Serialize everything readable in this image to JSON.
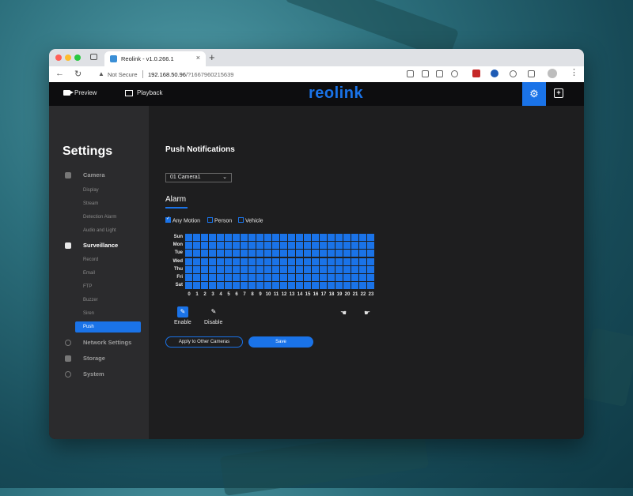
{
  "browser": {
    "tab_title": "Reolink - v1.0.266.1",
    "tab_close": "×",
    "new_tab": "+",
    "security_label": "Not Secure",
    "url_host": "192.168.50.96",
    "url_path": "/?1667960215639"
  },
  "app": {
    "logo": "reolink",
    "header_nav": [
      "Preview",
      "Playback"
    ]
  },
  "sidebar": {
    "title": "Settings",
    "sections": [
      {
        "label": "Camera",
        "icon": "camera-icon",
        "items": [
          "Display",
          "Stream",
          "Detection Alarm",
          "Audio and Light"
        ]
      },
      {
        "label": "Surveillance",
        "icon": "surveillance-icon",
        "active": true,
        "items": [
          "Record",
          "Email",
          "FTP",
          "Buzzer",
          "Siren",
          "Push"
        ]
      },
      {
        "label": "Network Settings",
        "icon": "globe-icon"
      },
      {
        "label": "Storage",
        "icon": "storage-icon"
      },
      {
        "label": "System",
        "icon": "gear-icon"
      }
    ],
    "active_item": "Push"
  },
  "main": {
    "title": "Push Notifications",
    "camera_select": "01  Camera1",
    "tab": "Alarm",
    "checkboxes": [
      {
        "label": "Any Motion",
        "checked": true
      },
      {
        "label": "Person",
        "checked": false
      },
      {
        "label": "Vehicle",
        "checked": false
      }
    ],
    "days": [
      "Sun",
      "Mon",
      "Tue",
      "Wed",
      "Thu",
      "Fri",
      "Sat"
    ],
    "hours": [
      "0",
      "1",
      "2",
      "3",
      "4",
      "5",
      "6",
      "7",
      "8",
      "9",
      "10",
      "11",
      "12",
      "13",
      "14",
      "15",
      "16",
      "17",
      "18",
      "19",
      "20",
      "21",
      "22",
      "23"
    ],
    "schedule_all_enabled": true,
    "enable_label": "Enable",
    "disable_label": "Disable",
    "apply_button": "Apply to Other Cameras",
    "save_button": "Save"
  },
  "colors": {
    "accent": "#1a73e8",
    "header_bg": "#0d0d0f",
    "sidebar_bg": "#2b2b2d",
    "main_bg": "#1e1e1f"
  }
}
